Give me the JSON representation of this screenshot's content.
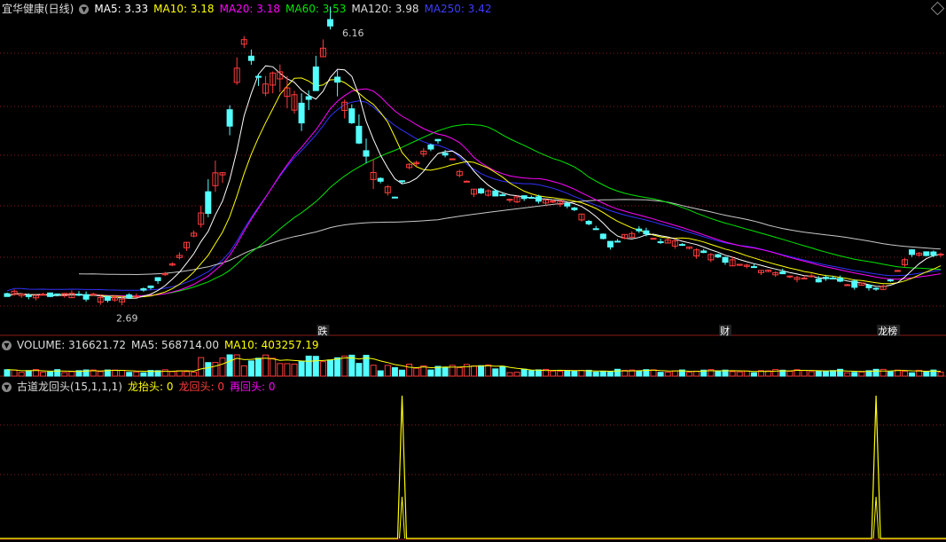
{
  "header": {
    "stock_name": "宜华健康(日线)",
    "ma5": "MA5: 3.33",
    "ma10": "MA10: 3.18",
    "ma20": "MA20: 3.18",
    "ma60": "MA60: 3.53",
    "ma120": "MA120: 3.98",
    "ma250": "MA250: 3.42"
  },
  "volume_header": {
    "title": "VOLUME: 316621.72",
    "ma5": "MA5: 568714.00",
    "ma10": "MA10: 403257.19"
  },
  "indicator_header": {
    "title": "古道龙回头(15,1,1,1)",
    "s1": "龙抬头: 0",
    "s2": "龙回头: 0",
    "s3": "再回头: 0"
  },
  "colors": {
    "up": "#ff3c3c",
    "down": "#54ffff",
    "ma5": "#ffffff",
    "ma10": "#ffff00",
    "ma20": "#ff00ff",
    "ma60": "#00e600",
    "ma120": "#c8c8c8",
    "ma250": "#3232ff",
    "grid": "#8b1a1a",
    "ind_line": "#ffff00"
  },
  "chart_data": [
    {
      "type": "candlestick",
      "title": "宜华健康(日线)",
      "y_range": [
        2.5,
        6.3
      ],
      "annotations": [
        {
          "label": "6.16",
          "value": 6.16
        },
        {
          "label": "2.69",
          "value": 2.69
        }
      ],
      "markers": [
        {
          "label": "跌",
          "index": 44
        },
        {
          "label": "财",
          "index": 100
        },
        {
          "label": "龙榜",
          "index": 122
        }
      ],
      "series": [
        {
          "name": "MA5",
          "value": 3.33
        },
        {
          "name": "MA10",
          "value": 3.18
        },
        {
          "name": "MA20",
          "value": 3.18
        },
        {
          "name": "MA60",
          "value": 3.53
        },
        {
          "name": "MA120",
          "value": 3.98
        },
        {
          "name": "MA250",
          "value": 3.42
        }
      ]
    },
    {
      "type": "bar",
      "title": "VOLUME",
      "series": [
        {
          "name": "VOLUME",
          "value": 316621.72
        },
        {
          "name": "MA5",
          "value": 568714.0
        },
        {
          "name": "MA10",
          "value": 403257.19
        }
      ]
    },
    {
      "type": "line",
      "title": "古道龙回头(15,1,1,1)",
      "series": [
        {
          "name": "龙抬头",
          "value": 0
        },
        {
          "name": "龙回头",
          "value": 0
        },
        {
          "name": "再回头",
          "value": 0
        }
      ],
      "spikes": [
        {
          "index": 55,
          "value": 1
        },
        {
          "index": 121,
          "value": 1
        }
      ]
    }
  ]
}
